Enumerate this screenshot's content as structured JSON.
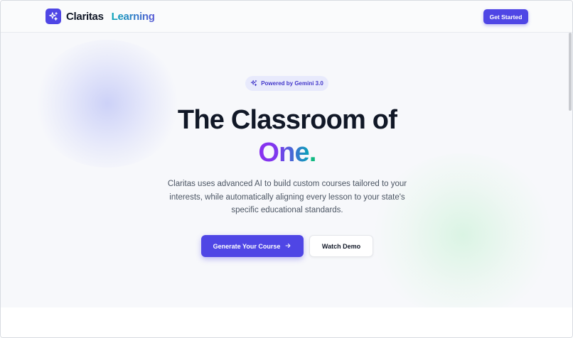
{
  "header": {
    "brand_name": "Claritas",
    "brand_accent": "Learning",
    "cta_label": "Get Started",
    "logo_icon": "sparkles-icon"
  },
  "hero": {
    "badge_text": "Powered by Gemini 3.0",
    "badge_icon": "sparkles-icon",
    "headline": "The Classroom of",
    "headline_accent": "One",
    "headline_punct": ".",
    "subtext": "Claritas uses advanced AI to build custom courses tailored to your interests, while automatically aligning every lesson to your state's specific educational standards.",
    "primary_cta": "Generate Your Course",
    "primary_cta_icon": "arrow-right-icon",
    "secondary_cta": "Watch Demo"
  },
  "colors": {
    "brand": "#4f46e5",
    "accent_dot": "#10b981",
    "text_dark": "#111827",
    "text_muted": "#4b5563"
  }
}
